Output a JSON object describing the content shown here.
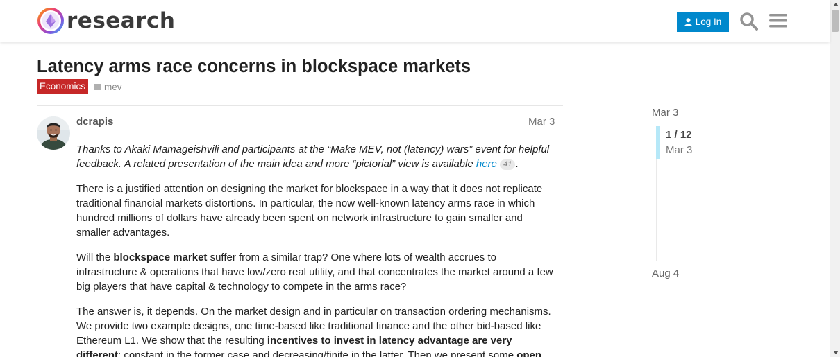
{
  "header": {
    "logo_text": "research",
    "login_label": "Log In",
    "icons": {
      "logo": "research-logo-icon",
      "user": "user-icon",
      "search": "search-icon",
      "menu": "hamburger-menu-icon"
    },
    "accent_color": "#0088cc"
  },
  "topic": {
    "title": "Latency arms race concerns in blockspace markets",
    "category": "Economics",
    "category_color": "#c62828",
    "tag": "mev"
  },
  "post": {
    "username": "dcrapis",
    "date": "Mar 3",
    "p1_text": "Thanks to Akaki Mamageishvili and participants at the “Make MEV, not (latency) wars” event for helpful feedback. A related presentation of the main idea and more “pictorial” view is available ",
    "p1_link": "here",
    "p1_link_clicks": "41",
    "p1_end": ".",
    "p2": "There is a justified attention on designing the market for blockspace in a way that it does not replicate traditional financial markets distortions. In particular, the now well-known latency arms race in which hundred millions of dollars have already been spent on network infrastructure to gain smaller and smaller advantages.",
    "p3_a": "Will the ",
    "p3_bold": "blockspace market",
    "p3_b": " suffer from a similar trap? One where lots of wealth accrues to infrastructure & operations that have low/zero real utility, and that concentrates the market around a few big players that have capital & technology to compete in the arms race?",
    "p4_a": "The answer is, it depends. On the market design and in particular on transaction ordering mechanisms. We provide two example designs, one time-based like traditional finance and the other bid-based like Ethereum L1. We show that the resulting ",
    "p4_bold": "incentives to invest in latency advantage are very different",
    "p4_b": ": constant in the former case and decreasing/finite in the latter. Then we present some ",
    "p4_bold2": "open"
  },
  "timeline": {
    "start_date": "Mar 3",
    "position": "1 / 12",
    "position_date": "Mar 3",
    "end_date": "Aug 4"
  }
}
